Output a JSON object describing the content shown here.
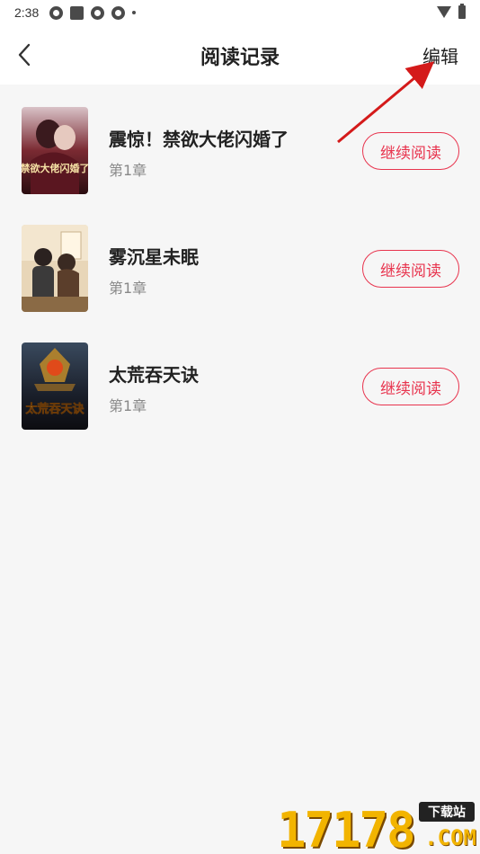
{
  "status_bar": {
    "time": "2:38"
  },
  "header": {
    "title": "阅读记录",
    "edit_label": "编辑"
  },
  "books": [
    {
      "title": "震惊！禁欲大佬闪婚了",
      "chapter": "第1章",
      "action_label": "继续阅读",
      "cover_text": "禁欲大佬闪婚了"
    },
    {
      "title": "雾沉星未眠",
      "chapter": "第1章",
      "action_label": "继续阅读"
    },
    {
      "title": "太荒吞天诀",
      "chapter": "第1章",
      "action_label": "继续阅读",
      "cover_text": "太荒吞天诀"
    }
  ],
  "watermark": {
    "digits": "17178",
    "badge": "下载站",
    "suffix": ".COM"
  },
  "colors": {
    "accent": "#e8344e",
    "background": "#f6f6f6",
    "watermark": "#f2b400"
  }
}
